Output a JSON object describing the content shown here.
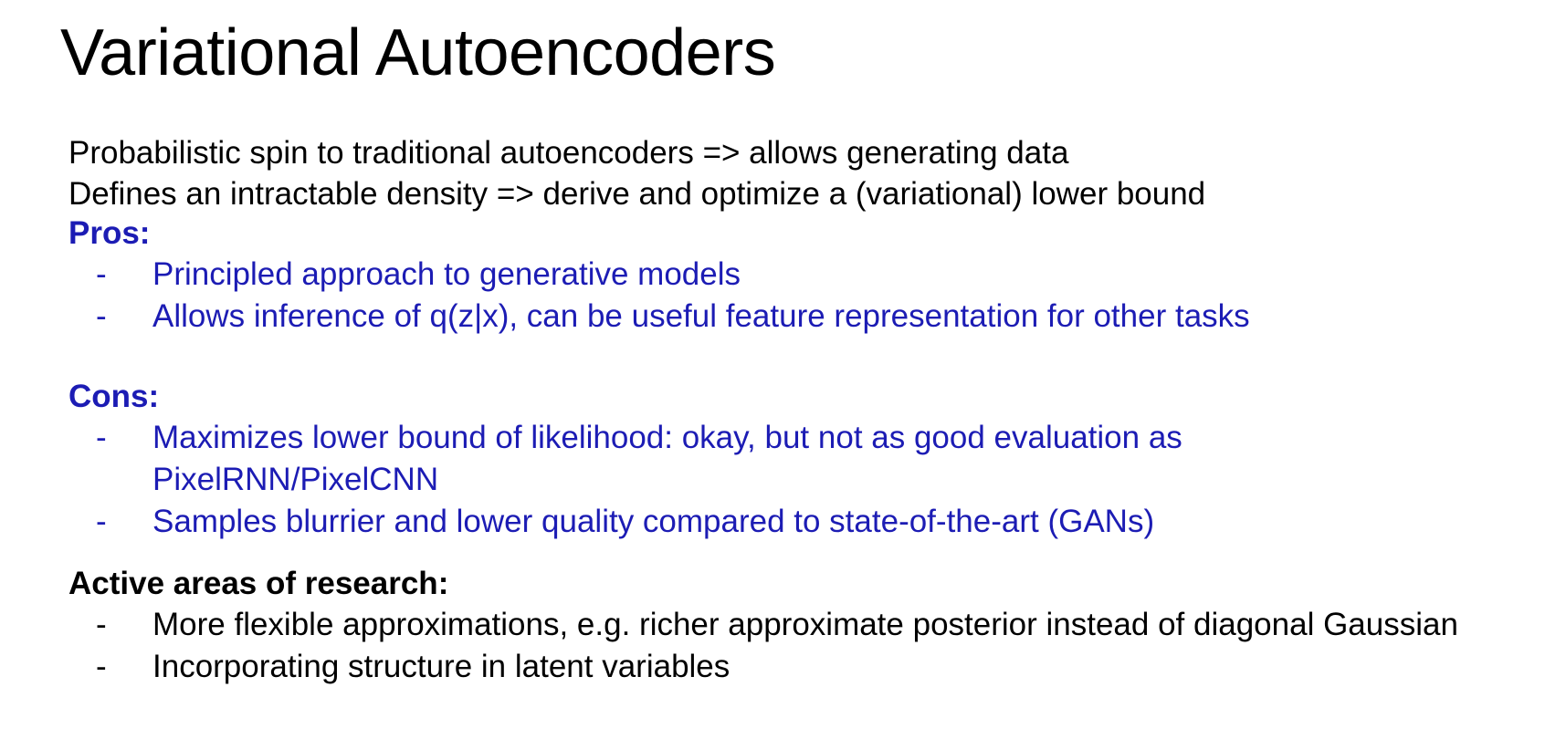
{
  "slide": {
    "title": "Variational Autoencoders",
    "intro": [
      "Probabilistic spin to traditional autoencoders => allows generating data",
      "Defines an intractable density => derive and optimize a (variational) lower bound"
    ],
    "pros": {
      "heading": "Pros:",
      "items": [
        "Principled approach to generative models",
        "Allows inference of q(z|x), can be useful feature representation for other tasks"
      ]
    },
    "cons": {
      "heading": "Cons:",
      "items": [
        "Maximizes lower bound of likelihood: okay, but not as good evaluation as PixelRNN/PixelCNN",
        "Samples blurrier and lower quality compared to state-of-the-art (GANs)"
      ]
    },
    "research": {
      "heading": "Active areas of research:",
      "items": [
        "More flexible approximations, e.g. richer approximate posterior instead of diagonal Gaussian",
        "Incorporating structure in latent variables"
      ]
    },
    "bullet_marker": "-",
    "colors": {
      "text": "#000000",
      "accent_blue": "#1c1cb4",
      "background": "#ffffff"
    }
  }
}
